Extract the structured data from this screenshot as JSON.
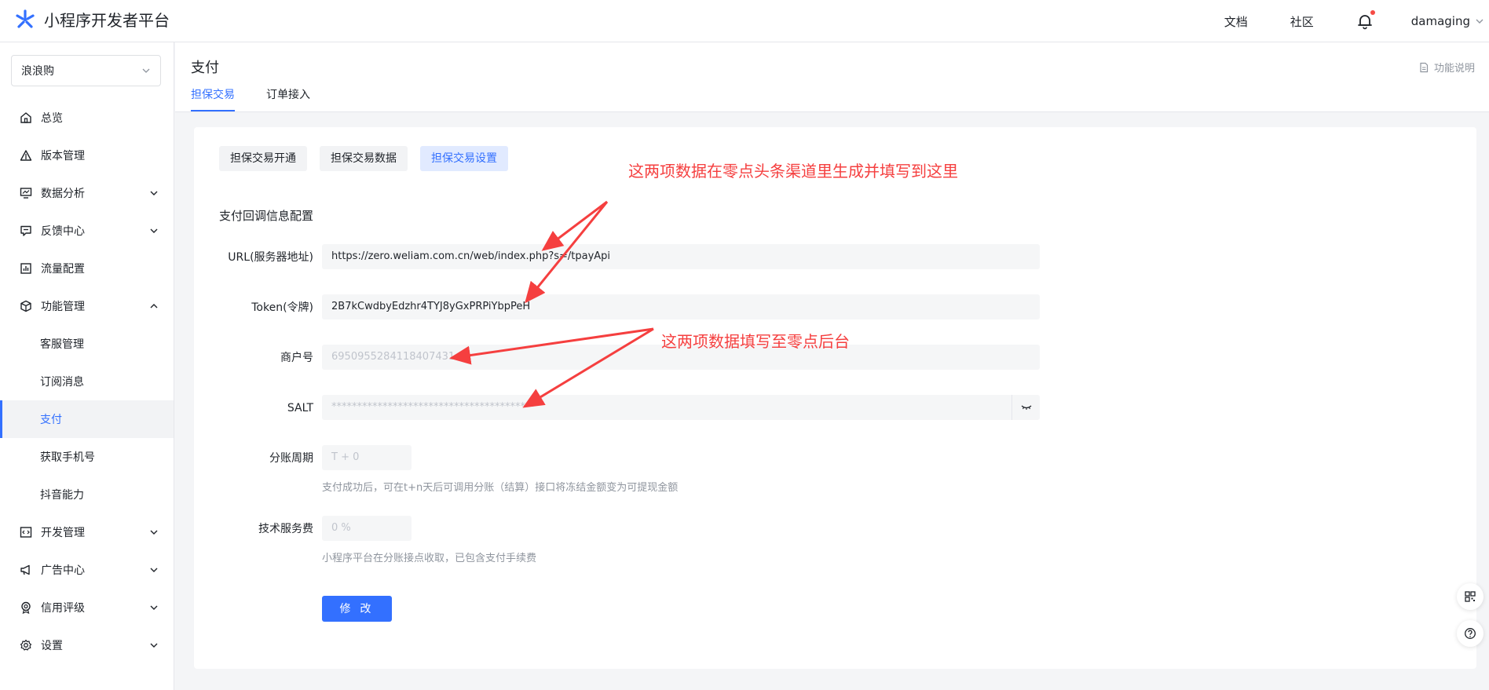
{
  "header": {
    "app_title": "小程序开发者平台",
    "docs_link": "文档",
    "community_link": "社区",
    "username": "damaging"
  },
  "sidebar": {
    "app_selector": "浪浪购",
    "items": [
      {
        "label": "总览"
      },
      {
        "label": "版本管理"
      },
      {
        "label": "数据分析"
      },
      {
        "label": "反馈中心"
      },
      {
        "label": "流量配置"
      },
      {
        "label": "功能管理"
      },
      {
        "label": "客服管理"
      },
      {
        "label": "订阅消息"
      },
      {
        "label": "支付"
      },
      {
        "label": "获取手机号"
      },
      {
        "label": "抖音能力"
      },
      {
        "label": "开发管理"
      },
      {
        "label": "广告中心"
      },
      {
        "label": "信用评级"
      },
      {
        "label": "设置"
      }
    ]
  },
  "page": {
    "title": "支付",
    "doc_link": "功能说明",
    "tabs": [
      {
        "label": "担保交易"
      },
      {
        "label": "订单接入"
      }
    ],
    "subtabs": [
      {
        "label": "担保交易开通"
      },
      {
        "label": "担保交易数据"
      },
      {
        "label": "担保交易设置"
      }
    ],
    "section_title": "支付回调信息配置"
  },
  "form": {
    "url": {
      "label": "URL(服务器地址)",
      "value": "https://zero.weliam.com.cn/web/index.php?s=/tpayApi"
    },
    "token": {
      "label": "Token(令牌)",
      "value": "2B7kCwdbyEdzhr4TYJ8yGxPRPiYbpPeH"
    },
    "merchant": {
      "label": "商户号",
      "value": "69509552841184074​31"
    },
    "salt": {
      "label": "SALT",
      "value": "****************************************"
    },
    "cycle": {
      "label": "分账周期",
      "value": "T + 0",
      "hint": "支付成功后，可在t+n天后可调用分账（结算）接口将冻结金额变为可提现金额"
    },
    "fee": {
      "label": "技术服务费",
      "value": "0 %",
      "hint": "小程序平台在分账接点收取，已包含支付手续费"
    },
    "submit_label": "修 改"
  },
  "annotations": {
    "note1": "这两项数据在零点头条渠道里生成并填写到这里",
    "note2": "这两项数据填写至零点后台"
  },
  "colors": {
    "primary": "#3370ff",
    "annotation": "#f53f3f"
  }
}
